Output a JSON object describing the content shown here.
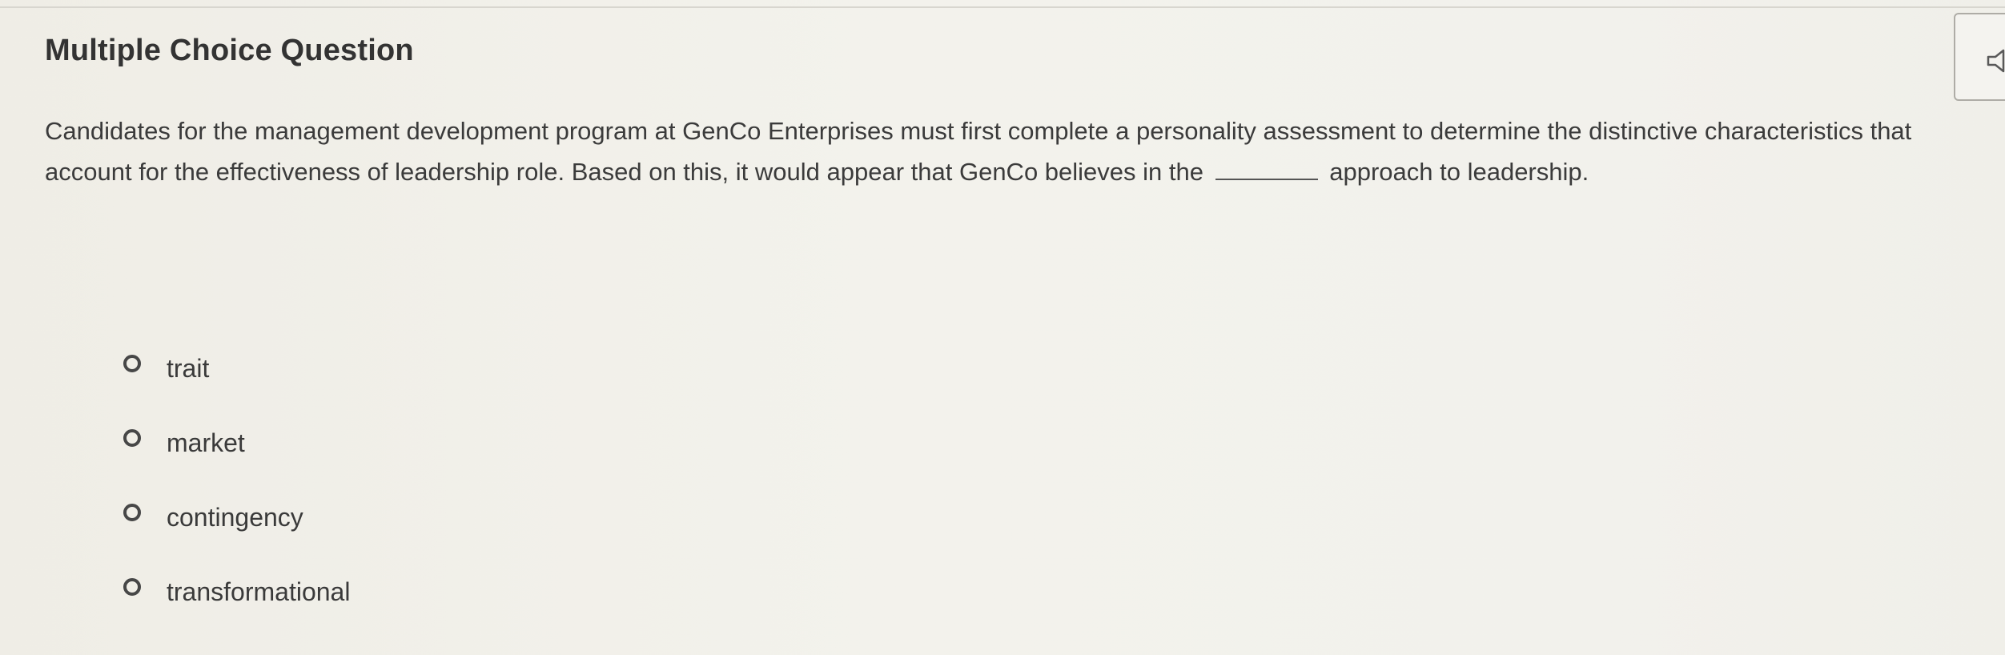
{
  "question": {
    "title": "Multiple Choice Question",
    "text_before_blank": "Candidates for the management development program at GenCo Enterprises must first complete a personality assessment to determine the distinctive characteristics that account for the effectiveness of leadership role. Based on this, it would appear that GenCo believes in the",
    "text_after_blank": "approach to leadership.",
    "speaker_icon": "speaker-icon"
  },
  "options": [
    {
      "label": "trait",
      "selected": false
    },
    {
      "label": "market",
      "selected": false
    },
    {
      "label": "contingency",
      "selected": false
    },
    {
      "label": "transformational",
      "selected": false
    }
  ],
  "colors": {
    "background": "#f1f0eb",
    "text": "#3a3a3a",
    "radio_border": "#474747"
  }
}
